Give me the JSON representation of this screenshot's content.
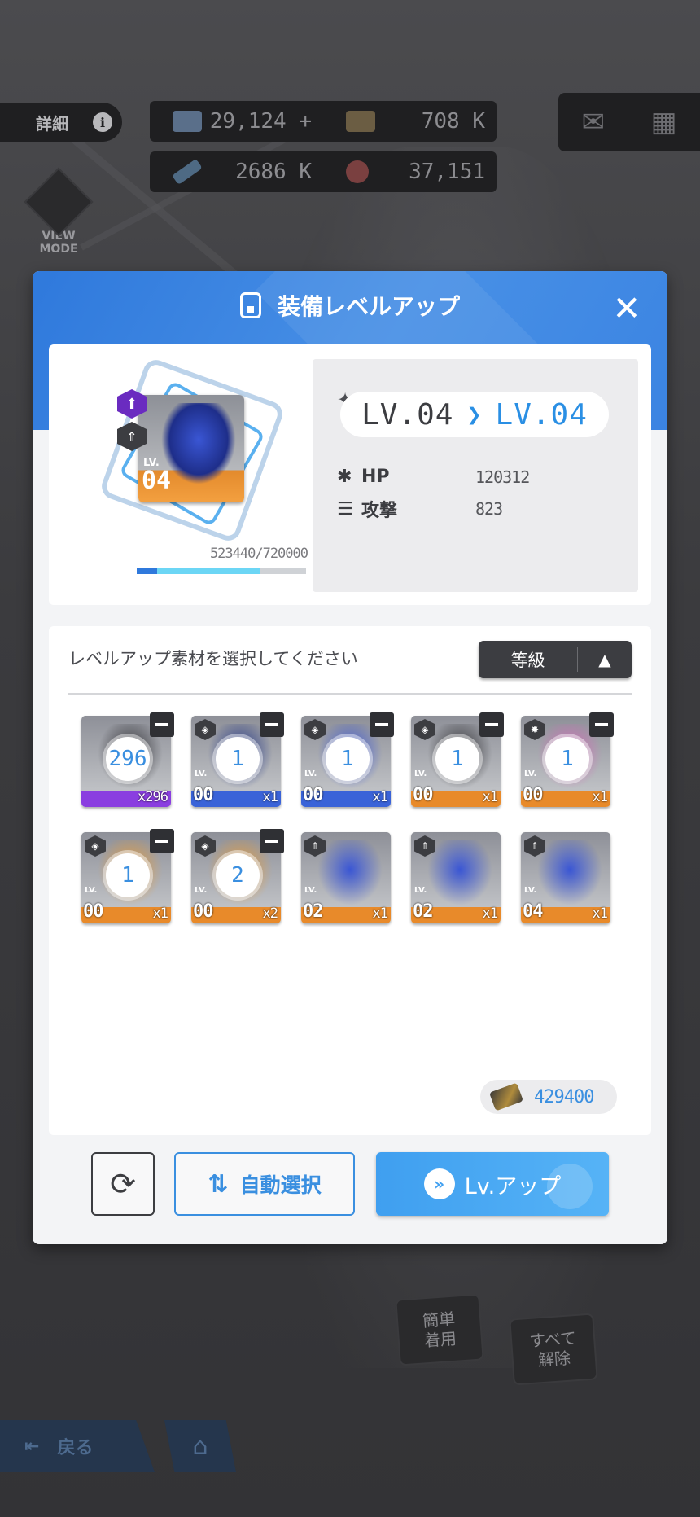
{
  "background": {
    "detail_label": "詳細",
    "resources_row1": [
      "29,124 +",
      "708 K"
    ],
    "resources_row2": [
      "2686 K",
      "37,151"
    ],
    "view_mode": "VIEW MODE",
    "back_label": "戻る",
    "easy_equip": "簡単\n着用",
    "release_all": "すべて\n解除"
  },
  "modal": {
    "title": "装備レベルアップ",
    "equipment": {
      "level_label": "LV.",
      "level": "04",
      "exp_text": "523440/720000",
      "exp_fraction": 0.727
    },
    "stats": {
      "lv_from": "LV.04",
      "lv_to": "LV.04",
      "hp_label": "HP",
      "hp_value": "120312",
      "atk_label": "攻撃",
      "atk_value": "823"
    },
    "materials": {
      "prompt": "レベルアップ素材を選択してください",
      "sort_label": "等級",
      "items": [
        {
          "count": "296",
          "level": "",
          "qty": "x296",
          "rarity": "#8a3ee0",
          "art": "#2b2b30",
          "badge": "",
          "selected": true
        },
        {
          "count": "1",
          "level": "00",
          "qty": "x1",
          "rarity": "#3a63d8",
          "art": "#1b2f82",
          "badge": "shield",
          "selected": true
        },
        {
          "count": "1",
          "level": "00",
          "qty": "x1",
          "rarity": "#3a63d8",
          "art": "#3a56d4",
          "badge": "shield",
          "selected": true
        },
        {
          "count": "1",
          "level": "00",
          "qty": "x1",
          "rarity": "#e88a2a",
          "art": "#2a2a2e",
          "badge": "shield",
          "selected": true
        },
        {
          "count": "1",
          "level": "00",
          "qty": "x1",
          "rarity": "#e88a2a",
          "art": "#d26ab8",
          "badge": "star",
          "selected": true
        },
        {
          "count": "1",
          "level": "00",
          "qty": "x1",
          "rarity": "#e88a2a",
          "art": "#e39a3a",
          "badge": "shield",
          "selected": true
        },
        {
          "count": "2",
          "level": "00",
          "qty": "x2",
          "rarity": "#e88a2a",
          "art": "#e39a3a",
          "badge": "shield",
          "selected": true
        },
        {
          "count": "",
          "level": "02",
          "qty": "x1",
          "rarity": "#e88a2a",
          "art": "#3a56d4",
          "badge": "arrow",
          "selected": false
        },
        {
          "count": "",
          "level": "02",
          "qty": "x1",
          "rarity": "#e88a2a",
          "art": "#3a56d4",
          "badge": "arrow",
          "selected": false
        },
        {
          "count": "",
          "level": "04",
          "qty": "x1",
          "rarity": "#e88a2a",
          "art": "#3a56d4",
          "badge": "arrow",
          "selected": false
        }
      ],
      "gold": "429400"
    },
    "buttons": {
      "auto_select": "自動選択",
      "level_up": "Lv.アップ"
    }
  }
}
